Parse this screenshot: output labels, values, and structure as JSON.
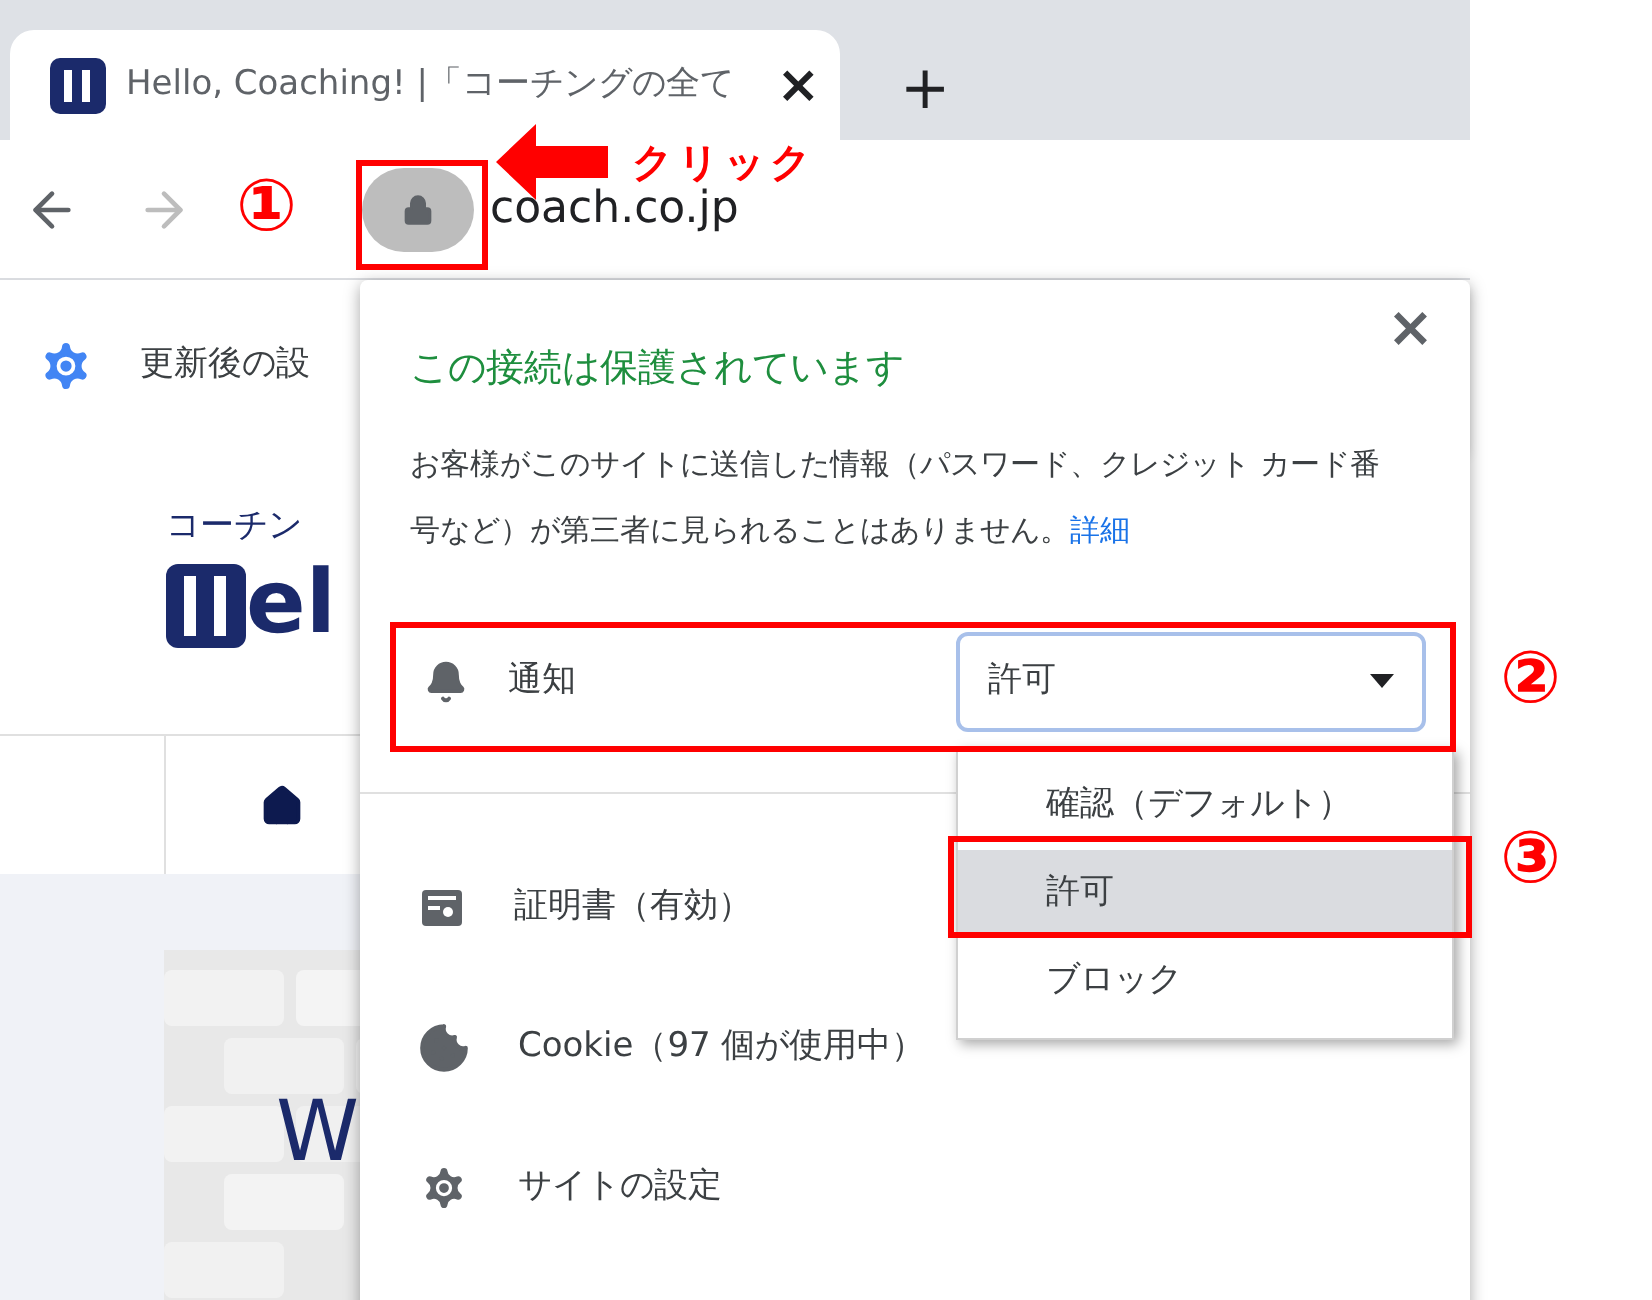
{
  "tab": {
    "title": "Hello, Coaching! |「コーチングの全て",
    "close": "×"
  },
  "new_tab": "+",
  "address": {
    "url": "coach.co.jp"
  },
  "page": {
    "banner": "更新後の設",
    "tagline": "コーチン",
    "logo_text": "el",
    "hero_text": "W"
  },
  "popup": {
    "close": "×",
    "title": "この接続は保護されています",
    "description": "お客様がこのサイトに送信した情報（パスワード、クレジット カード番号など）が第三者に見られることはありません。",
    "details_link": "詳細",
    "permission": {
      "label": "通知",
      "value": "許可"
    },
    "items": [
      {
        "kind": "certificate",
        "label": "証明書（有効）"
      },
      {
        "kind": "cookie",
        "label": "Cookie（97 個が使用中）"
      },
      {
        "kind": "settings",
        "label": "サイトの設定"
      }
    ],
    "dropdown": [
      {
        "label": "確認（デフォルト）",
        "selected": false
      },
      {
        "label": "許可",
        "selected": true
      },
      {
        "label": "ブロック",
        "selected": false
      }
    ]
  },
  "annotations": {
    "click_label": "クリック",
    "steps": [
      "①",
      "②",
      "③"
    ]
  }
}
